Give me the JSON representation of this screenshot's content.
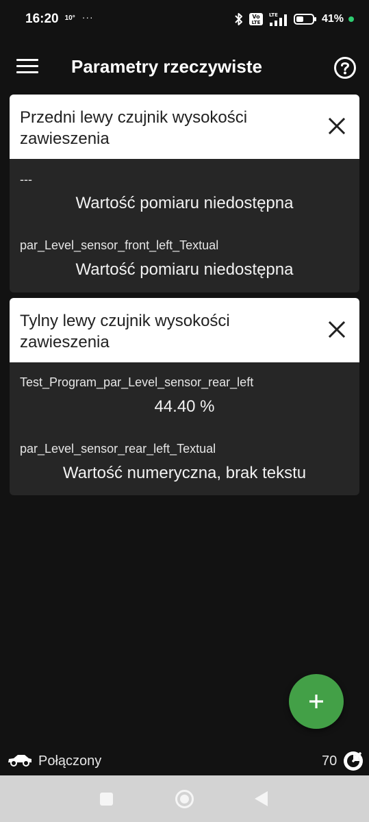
{
  "status_bar": {
    "time": "16:20",
    "temperature": "10°",
    "dots": "···",
    "battery": "41%",
    "icons": [
      "bluetooth-icon",
      "volte-icon",
      "lte-signal-icon",
      "battery-icon"
    ],
    "indicator_color": "#2ecc71"
  },
  "app_bar": {
    "title": "Parametry rzeczywiste",
    "menu_icon": "hamburger-menu-icon",
    "help_icon": "help-circle-icon"
  },
  "cards": [
    {
      "title": "Przedni lewy czujnik wysokości zawieszenia",
      "params": [
        {
          "name": "---",
          "value": "Wartość pomiaru niedostępna"
        },
        {
          "name": "par_Level_sensor_front_left_Textual",
          "value": "Wartość pomiaru niedostępna"
        }
      ]
    },
    {
      "title": "Tylny lewy czujnik wysokości zawieszenia",
      "params": [
        {
          "name": "Test_Program_par_Level_sensor_rear_left",
          "value": "44.40 %"
        },
        {
          "name": "par_Level_sensor_rear_left_Textual",
          "value": "Wartość numeryczna, brak tekstu"
        }
      ]
    }
  ],
  "fab": {
    "icon": "plus-icon",
    "color": "#43a047"
  },
  "bottom_status": {
    "connection": "Połączony",
    "counter": "70",
    "car_icon": "car-icon",
    "speed_icon": "gauge-icon"
  },
  "colors": {
    "background": "#121212",
    "card": "#262626",
    "card_header": "#ffffff",
    "nav_bar": "#d3d3d3"
  }
}
